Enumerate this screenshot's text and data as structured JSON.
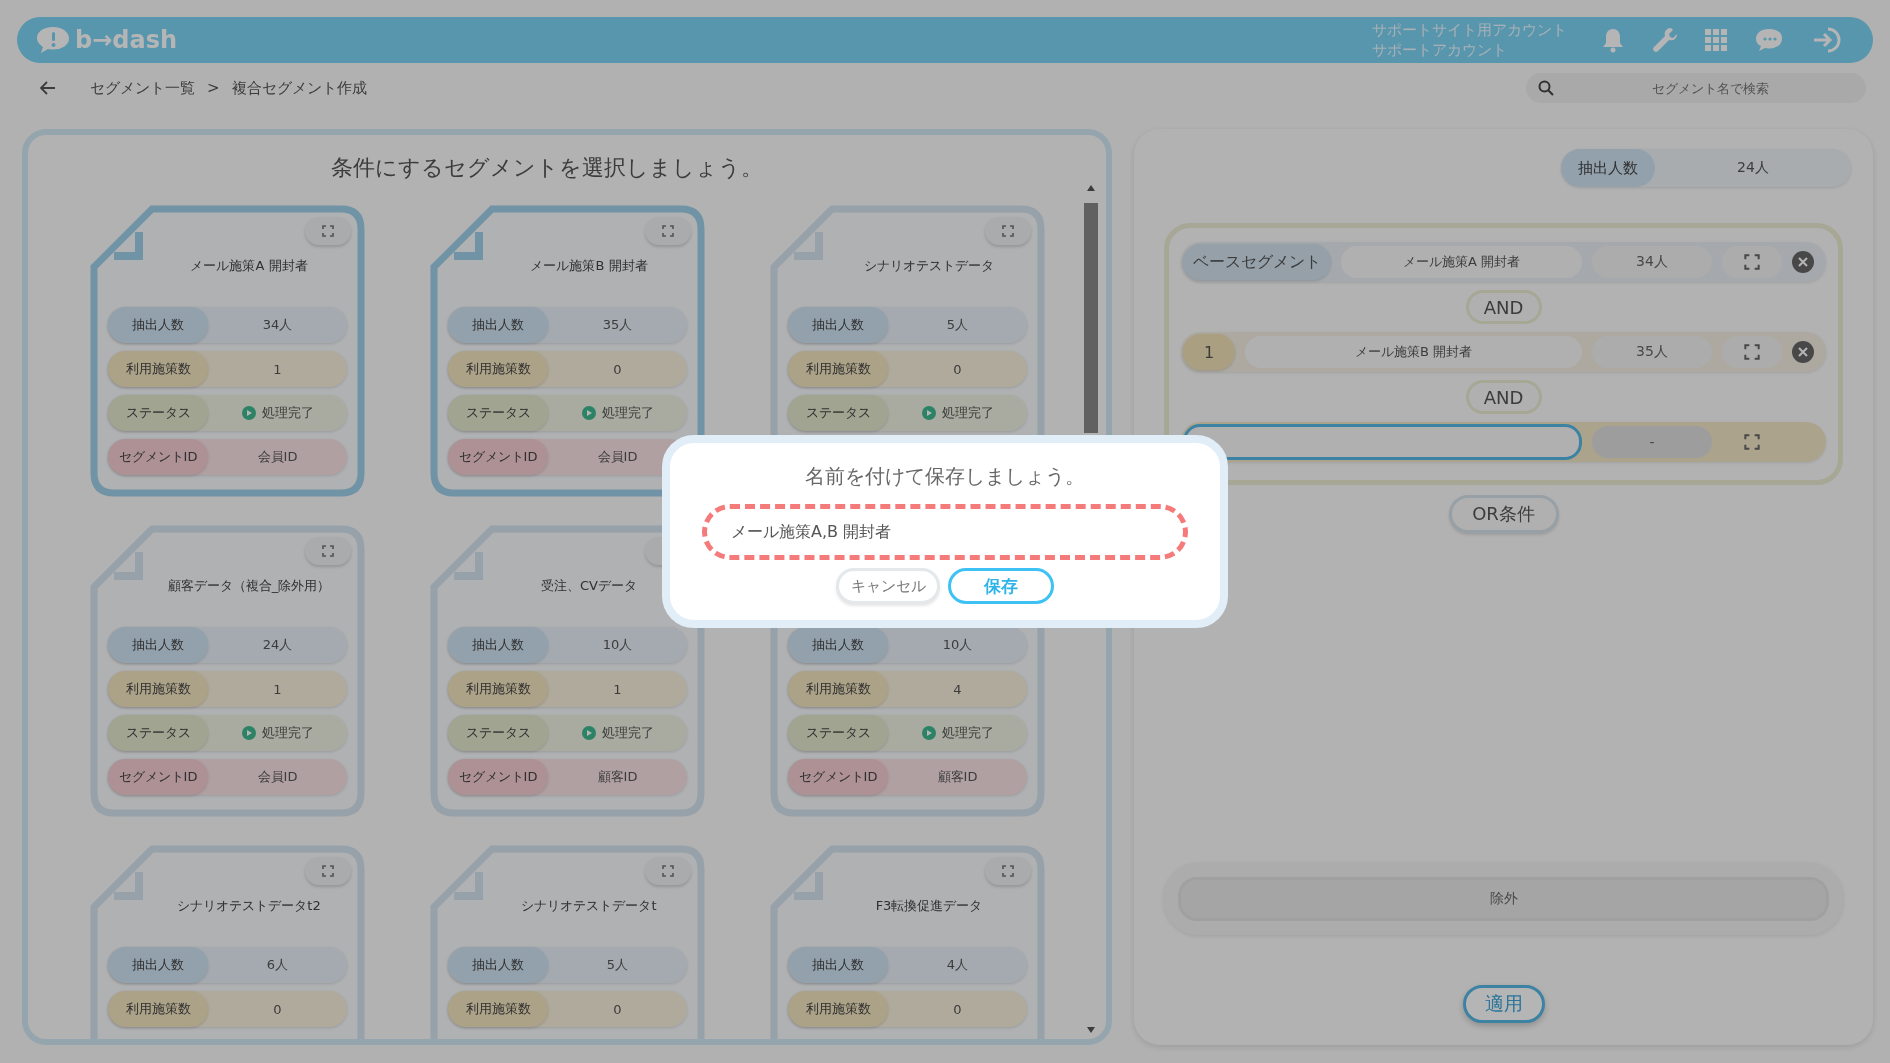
{
  "header": {
    "logo": "b→dash",
    "account_lines": [
      "サポートサイト用アカウント",
      "サポートアカウント"
    ]
  },
  "breadcrumb": {
    "items": [
      "セグメント一覧",
      "複合セグメント作成"
    ],
    "separator": ">"
  },
  "search": {
    "placeholder": "セグメント名で検索"
  },
  "segment_picker": {
    "title": "条件にするセグメントを選択しましょう。",
    "cards": [
      {
        "title": "メール施策A 開封者",
        "selected": true,
        "rows": [
          {
            "kind": "count",
            "label": "抽出人数",
            "value": "34人"
          },
          {
            "kind": "measures",
            "label": "利用施策数",
            "value": "1"
          },
          {
            "kind": "status",
            "label": "ステータス",
            "value": "処理完了"
          },
          {
            "kind": "segment_id",
            "label": "セグメントID",
            "value": "会員ID"
          }
        ]
      },
      {
        "title": "メール施策B 開封者",
        "selected": true,
        "rows": [
          {
            "kind": "count",
            "label": "抽出人数",
            "value": "35人"
          },
          {
            "kind": "measures",
            "label": "利用施策数",
            "value": "0"
          },
          {
            "kind": "status",
            "label": "ステータス",
            "value": "処理完了"
          },
          {
            "kind": "segment_id",
            "label": "セグメントID",
            "value": "会員ID"
          }
        ]
      },
      {
        "title": "シナリオテストデータ",
        "selected": false,
        "rows": [
          {
            "kind": "count",
            "label": "抽出人数",
            "value": "5人"
          },
          {
            "kind": "measures",
            "label": "利用施策数",
            "value": "0"
          },
          {
            "kind": "status",
            "label": "ステータス",
            "value": "処理完了"
          }
        ]
      },
      {
        "title": "顧客データ（複合_除外用）",
        "selected": false,
        "rows": [
          {
            "kind": "count",
            "label": "抽出人数",
            "value": "24人"
          },
          {
            "kind": "measures",
            "label": "利用施策数",
            "value": "1"
          },
          {
            "kind": "status",
            "label": "ステータス",
            "value": "処理完了"
          },
          {
            "kind": "segment_id",
            "label": "セグメントID",
            "value": "会員ID"
          }
        ]
      },
      {
        "title": "受注、CVデータ",
        "selected": false,
        "expand_icon_hidden": true,
        "rows": [
          {
            "kind": "count",
            "label": "抽出人数",
            "value": "10人"
          },
          {
            "kind": "measures",
            "label": "利用施策数",
            "value": "1"
          },
          {
            "kind": "status",
            "label": "ステータス",
            "value": "処理完了"
          },
          {
            "kind": "segment_id",
            "label": "セグメントID",
            "value": "顧客ID"
          }
        ]
      },
      {
        "selected": false,
        "rows": [
          {
            "kind": "count",
            "label": "抽出人数",
            "value": "10人"
          },
          {
            "kind": "measures",
            "label": "利用施策数",
            "value": "4"
          },
          {
            "kind": "status",
            "label": "ステータス",
            "value": "処理完了"
          },
          {
            "kind": "segment_id",
            "label": "セグメントID",
            "value": "顧客ID"
          }
        ]
      },
      {
        "title": "シナリオテストデータt2",
        "selected": false,
        "rows": [
          {
            "kind": "count",
            "label": "抽出人数",
            "value": "6人"
          },
          {
            "kind": "measures",
            "label": "利用施策数",
            "value": "0"
          }
        ]
      },
      {
        "title": "シナリオテストデータt",
        "selected": false,
        "rows": [
          {
            "kind": "count",
            "label": "抽出人数",
            "value": "5人"
          },
          {
            "kind": "measures",
            "label": "利用施策数",
            "value": "0"
          }
        ]
      },
      {
        "title": "F3転換促進データ",
        "selected": false,
        "rows": [
          {
            "kind": "count",
            "label": "抽出人数",
            "value": "4人"
          },
          {
            "kind": "measures",
            "label": "利用施策数",
            "value": "0"
          }
        ]
      }
    ]
  },
  "builder": {
    "total": {
      "label": "抽出人数",
      "value": "24人"
    },
    "conditions": [
      {
        "kind": "base",
        "tag": "ベースセグメント",
        "name": "メール施策A 開封者",
        "count": "34人",
        "removable": true
      },
      {
        "kind": "operator",
        "label": "AND"
      },
      {
        "kind": "segment",
        "tag": "1",
        "name": "メール施策B 開封者",
        "count": "35人",
        "removable": true
      },
      {
        "kind": "operator",
        "label": "AND"
      },
      {
        "kind": "empty",
        "count": "-",
        "removable": false
      }
    ],
    "or_button": "OR条件",
    "exclude": "除外",
    "apply_button": "適用"
  },
  "modal": {
    "title": "名前を付けて保存しましょう。",
    "name_value": "メール施策A,B 開封者",
    "buttons": [
      {
        "kind": "cancel",
        "label": "キャンセル"
      },
      {
        "kind": "save",
        "label": "保存"
      }
    ]
  }
}
